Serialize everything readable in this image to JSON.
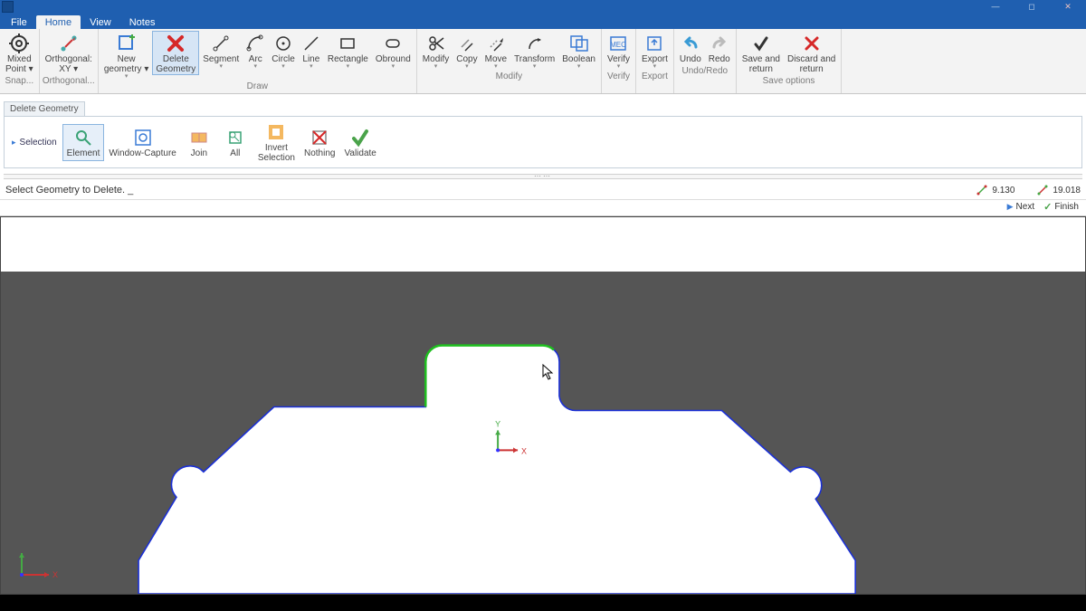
{
  "window": {
    "title": ""
  },
  "tabs": {
    "file": "File",
    "home": "Home",
    "view": "View",
    "notes": "Notes",
    "active": "home"
  },
  "ribbon": {
    "groups": {
      "snapping": {
        "label": "Snap...",
        "mixed_point": "Mixed\nPoint ▾"
      },
      "orthogonal": {
        "label": "Orthogonal...",
        "ortho_xy": "Orthogonal:\nXY ▾"
      },
      "draw": {
        "label": "Draw",
        "new_geometry": "New\ngeometry ▾",
        "delete_geometry": "Delete\nGeometry",
        "segment": "Segment",
        "arc": "Arc",
        "circle": "Circle",
        "line": "Line",
        "rectangle": "Rectangle",
        "obround": "Obround"
      },
      "modify": {
        "label": "Modify",
        "modify": "Modify",
        "copy": "Copy",
        "move": "Move",
        "transform": "Transform",
        "boolean": "Boolean"
      },
      "verify": {
        "label": "Verify",
        "verify": "Verify"
      },
      "export": {
        "label": "Export",
        "export": "Export"
      },
      "undoredo": {
        "label": "Undo/Redo",
        "undo": "Undo",
        "redo": "Redo"
      },
      "save_options": {
        "label": "Save options",
        "save_return": "Save and\nreturn",
        "discard_return": "Discard and\nreturn"
      }
    }
  },
  "delete_panel": {
    "title": "Delete Geometry",
    "selection_label": "Selection",
    "element": "Element",
    "window_capture": "Window-Capture",
    "join": "Join",
    "all": "All",
    "invert_selection": "Invert\nSelection",
    "nothing": "Nothing",
    "validate": "Validate"
  },
  "prompt": "Select Geometry to Delete.",
  "coords": {
    "a": "9.130",
    "b": "19.018"
  },
  "nav": {
    "next": "Next",
    "finish": "Finish"
  },
  "axes": {
    "x": "X",
    "y": "Y"
  }
}
